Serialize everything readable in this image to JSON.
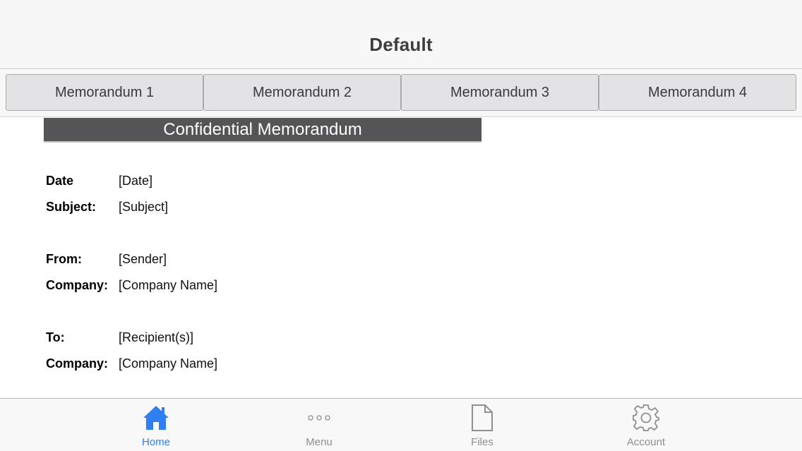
{
  "header": {
    "title": "Default"
  },
  "tabs": [
    {
      "label": "Memorandum 1"
    },
    {
      "label": "Memorandum 2"
    },
    {
      "label": "Memorandum 3"
    },
    {
      "label": "Memorandum 4"
    }
  ],
  "document": {
    "banner": "Confidential Memorandum",
    "fields": [
      {
        "label": "Date",
        "value": "[Date]"
      },
      {
        "label": "Subject:",
        "value": "[Subject]"
      },
      {
        "label": "From:",
        "value": "[Sender]"
      },
      {
        "label": "Company:",
        "value": "[Company Name]"
      },
      {
        "label": "To:",
        "value": "[Recipient(s)]"
      },
      {
        "label": "Company:",
        "value": "[Company Name]"
      }
    ]
  },
  "tab_bar": {
    "items": [
      {
        "label": "Home",
        "icon": "home-icon",
        "active": true
      },
      {
        "label": "Menu",
        "icon": "more-icon",
        "active": false
      },
      {
        "label": "Files",
        "icon": "file-icon",
        "active": false
      },
      {
        "label": "Account",
        "icon": "gear-icon",
        "active": false
      }
    ]
  },
  "colors": {
    "accent": "#2f7ff0",
    "inactive": "#8e8e93",
    "banner_bg": "#555457"
  }
}
